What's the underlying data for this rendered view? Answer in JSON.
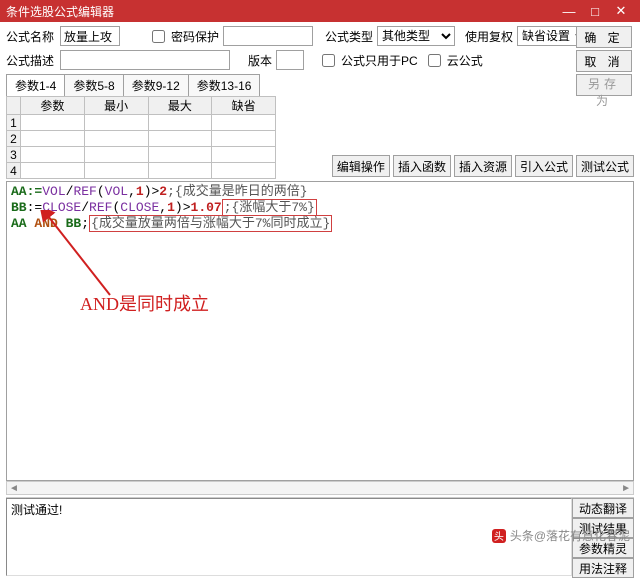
{
  "window": {
    "title": "条件选股公式编辑器"
  },
  "form": {
    "name_label": "公式名称",
    "name_value": "放量上攻",
    "desc_label": "公式描述",
    "pwd_label": "密码保护",
    "type_label": "公式类型",
    "type_value": "其他类型",
    "complex_label": "使用复权",
    "complex_value": "缺省设置",
    "version_label": "版本",
    "pc_only_label": "公式只用于PC",
    "cloud_label": "云公式"
  },
  "buttons": {
    "ok": "确 定",
    "cancel": "取 消",
    "saveas": "另存为",
    "edit_op": "编辑操作",
    "insert_func": "插入函数",
    "insert_res": "插入资源",
    "import_formula": "引入公式",
    "test_formula": "测试公式",
    "dyn_trans": "动态翻译",
    "test_result": "测试结果",
    "param_wizard": "参数精灵",
    "usage_comment": "用法注释"
  },
  "tabs": [
    "参数1-4",
    "参数5-8",
    "参数9-12",
    "参数13-16"
  ],
  "param_headers": [
    "参数",
    "最小",
    "最大",
    "缺省"
  ],
  "param_rows": [
    "1",
    "2",
    "3",
    "4"
  ],
  "code": {
    "l1_a": "AA:=",
    "l1_b": "VOL",
    "l1_c": "/",
    "l1_d": "REF",
    "l1_e": "(",
    "l1_f": "VOL",
    "l1_g": ",",
    "l1_h": "1",
    "l1_i": ")>",
    "l1_j": "2",
    "l1_k": ";{成交量是昨日的两倍}",
    "l2_a": "BB",
    "l2_b": ":=",
    "l2_c": "CLOSE",
    "l2_d": "/",
    "l2_e": "REF",
    "l2_f": "(",
    "l2_g": "CLOSE",
    "l2_h": ",",
    "l2_i": "1",
    "l2_j": ")>",
    "l2_k": "1.07",
    "l2_l": ";{涨幅大于7%}",
    "l3_a": "AA",
    "l3_b": " AND ",
    "l3_c": "BB",
    "l3_d": ";",
    "l3_e": "{成交量放量两倍与涨幅大于7%同时成立}"
  },
  "annotation": "AND是同时成立",
  "status": "测试通过!",
  "watermark": "头条@落花有意化春泥"
}
